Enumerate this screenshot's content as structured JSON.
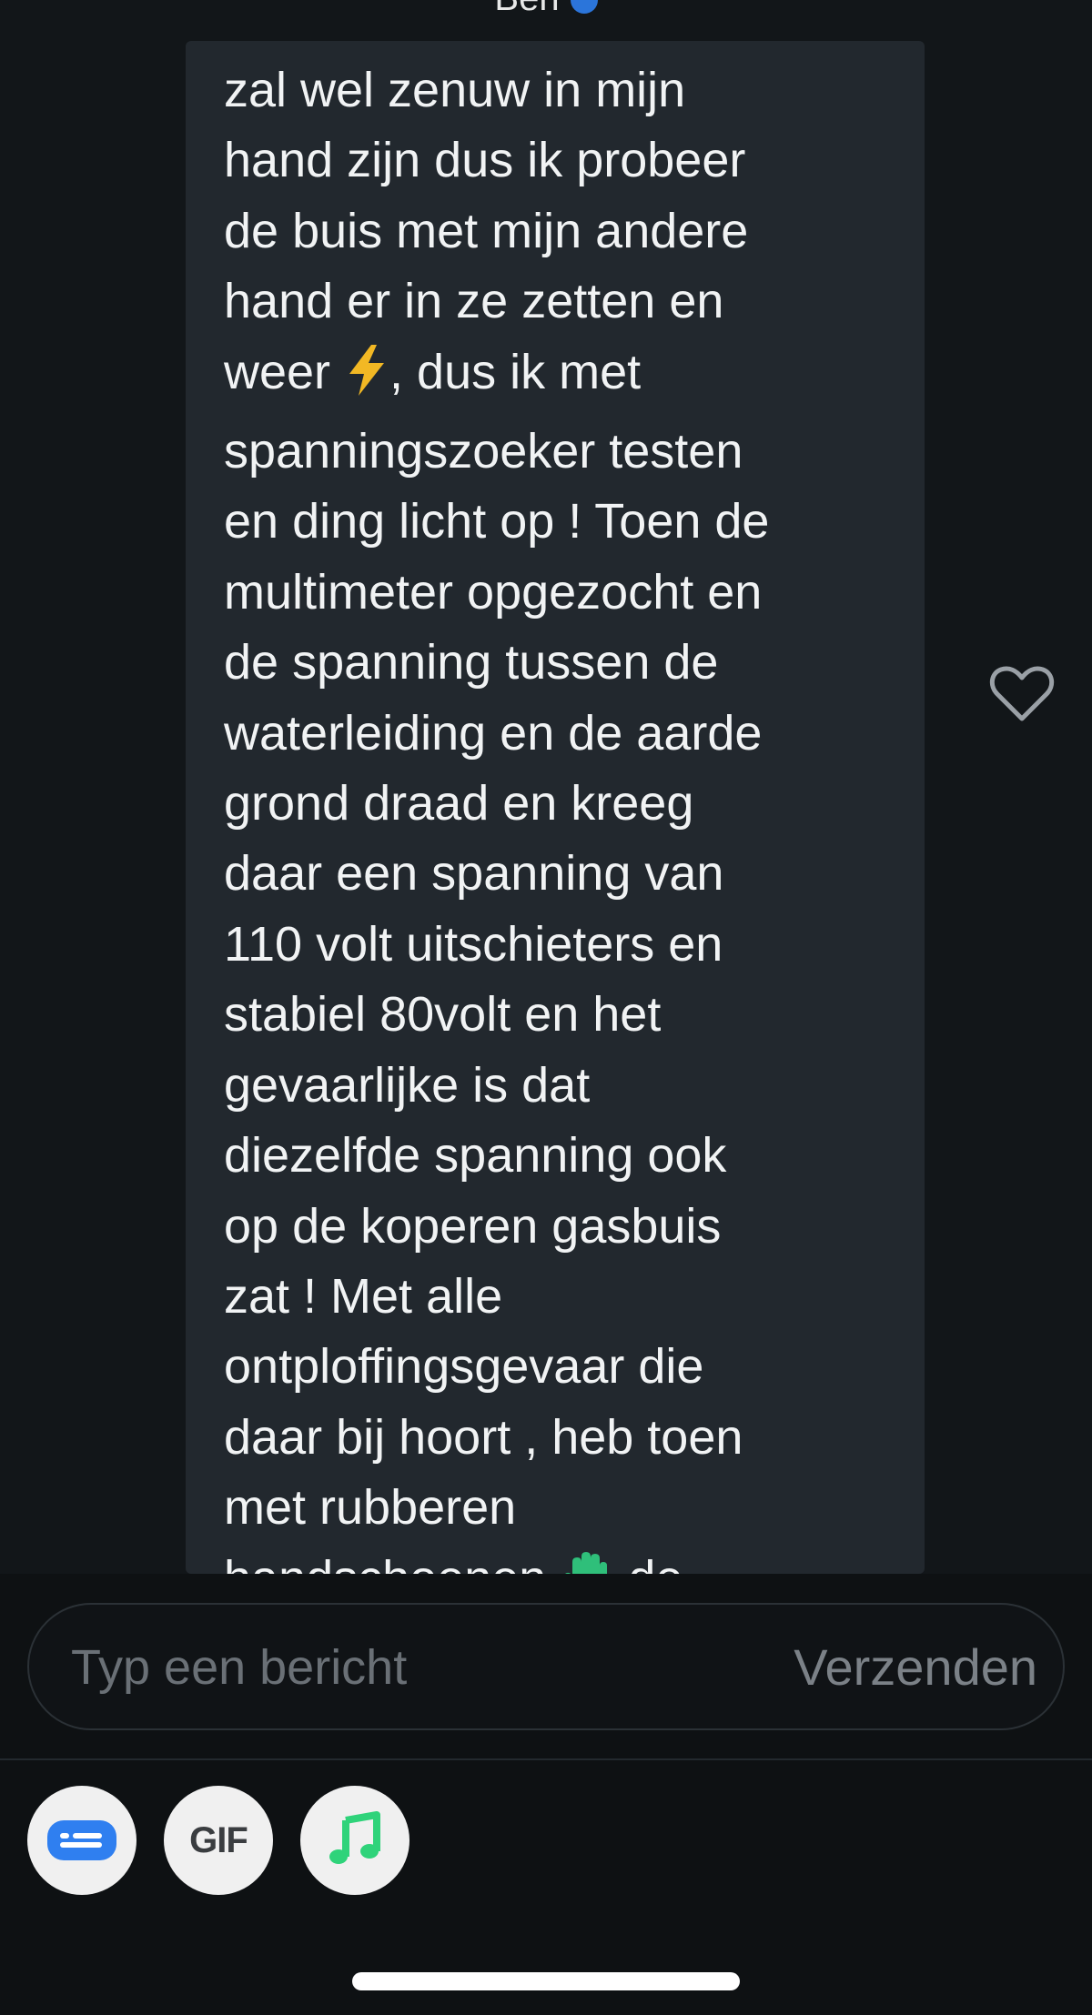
{
  "header": {
    "contact_name": "Ben"
  },
  "message": {
    "text_before_bolt": "zal wel zenuw in mijn\nhand zijn dus ik probeer\nde buis met mijn andere\nhand er in ze zetten en\nweer ",
    "bolt_emoji": "⚡",
    "text_after_bolt": ", dus ik met\nspanningszoeker testen\nen ding licht op ! Toen de\nmultimeter opgezocht en\nde spanning tussen de\nwaterleiding en de aarde\ngrond draad en kreeg\ndaar een spanning van\n110 volt uitschieters en\nstabiel 80volt  en het\ngevaarlijke is dat\ndiezelfde spanning ook\nop de koperen gasbuis\nzat ! Met alle\nontploffingsgevaar die\ndaar bij hoort , heb toen\nmet rubberen\nhandschoenen ",
    "glove_emoji": "🧤",
    "text_after_glove": " de"
  },
  "composer": {
    "placeholder": "Typ een bericht",
    "send_label": "Verzenden"
  },
  "actions": {
    "card_icon": "card-icon",
    "gif_label": "GIF",
    "music_icon": "music-note-icon"
  },
  "colors": {
    "background": "#121619",
    "bubble": "#22282e",
    "accent_blue": "#2f7ff0",
    "accent_green": "#2fd37a",
    "bolt": "#f2b824"
  }
}
